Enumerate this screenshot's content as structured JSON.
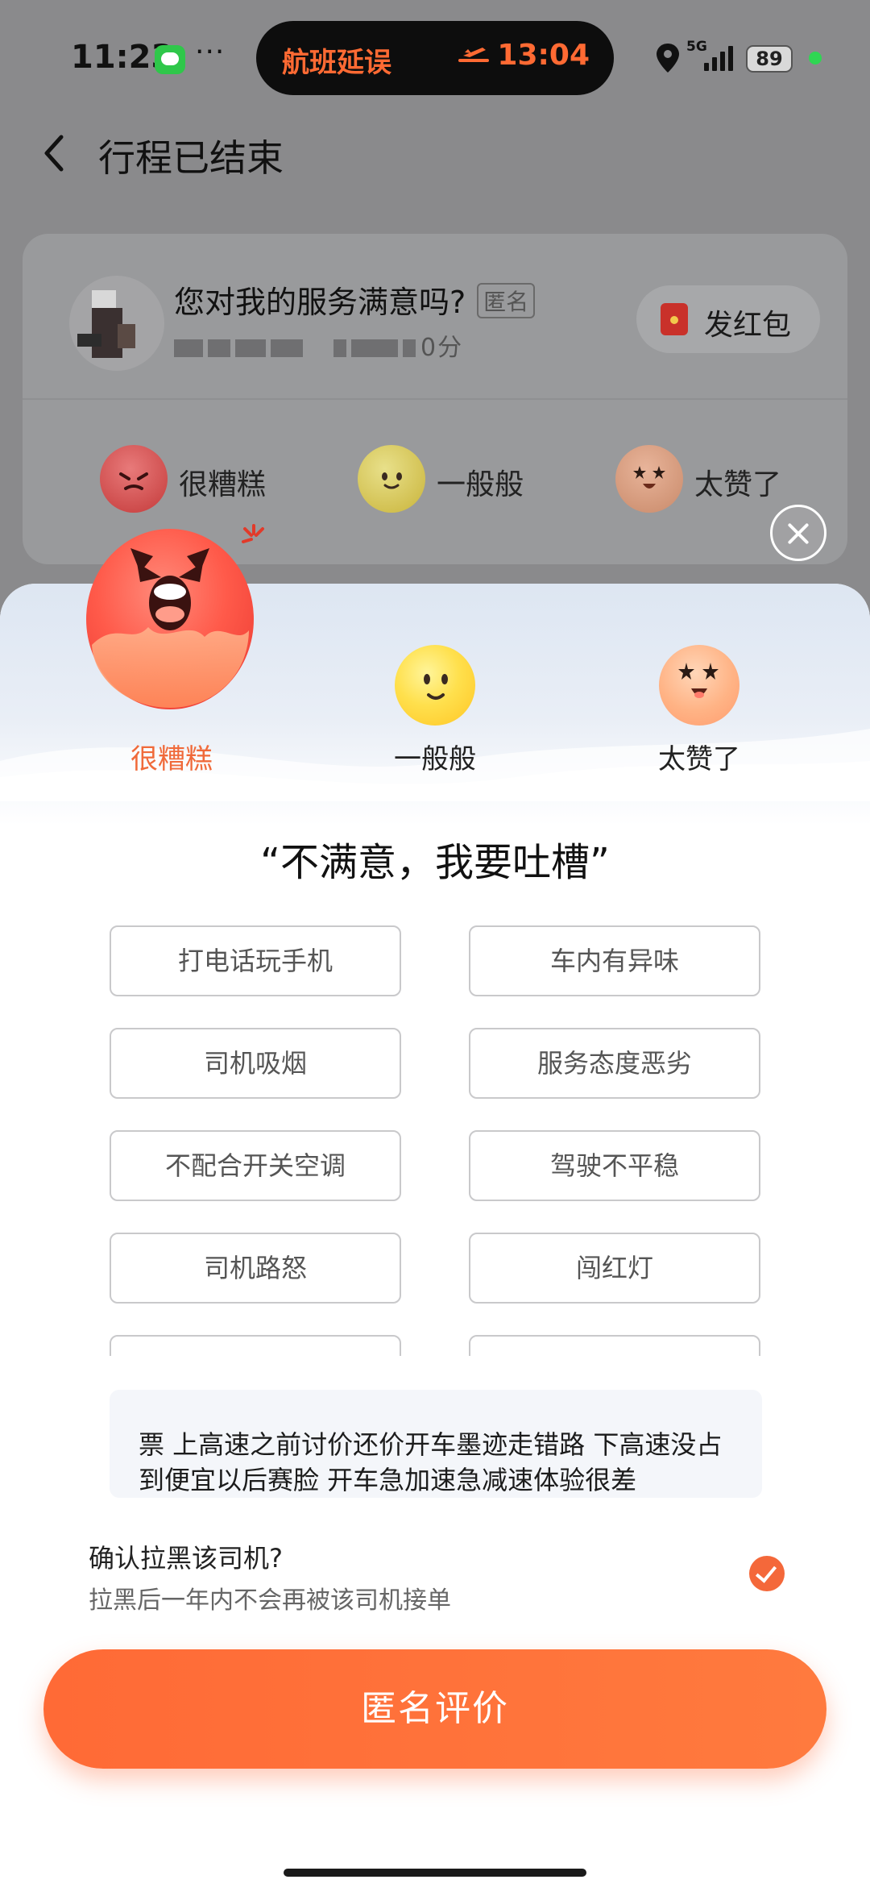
{
  "status_bar": {
    "time": "11:23",
    "island_left": "航班延误",
    "island_right": "13:04",
    "network": "5G",
    "battery": "89",
    "accent_color": "#ff6a33"
  },
  "nav": {
    "title": "行程已结束"
  },
  "driver_card": {
    "question": "您对我的服务满意吗?",
    "anonymous_tag": "匿名",
    "rating_suffix": "0分",
    "red_packet_label": "发红包",
    "ratings": [
      {
        "label": "很糟糕",
        "icon": "angry-face-icon"
      },
      {
        "label": "一般般",
        "icon": "neutral-face-icon"
      },
      {
        "label": "太赞了",
        "icon": "star-eyes-face-icon"
      }
    ]
  },
  "sheet": {
    "faces": [
      {
        "label": "很糟糕",
        "selected": true,
        "icon": "angry-face-icon"
      },
      {
        "label": "一般般",
        "selected": false,
        "icon": "neutral-face-icon"
      },
      {
        "label": "太赞了",
        "selected": false,
        "icon": "star-eyes-face-icon"
      }
    ],
    "quote": "“不满意，我要吐槽”",
    "tags": [
      "打电话玩手机",
      "车内有异味",
      "司机吸烟",
      "服务态度恶劣",
      "不配合开关空调",
      "驾驶不平稳",
      "司机路怒",
      "闯红灯",
      "",
      ""
    ],
    "comment": "票 上高速之前讨价还价开车墨迹走错路 下高速没占到便宜以后赛脸 开车急加速急减速体验很差",
    "block_title": "确认拉黑该司机?",
    "block_subtitle": "拉黑后一年内不会再被该司机接单",
    "block_checked": true,
    "submit_label": "匿名评价",
    "primary_color": "#ff6a36",
    "selected_label_color": "#f06a3a"
  }
}
